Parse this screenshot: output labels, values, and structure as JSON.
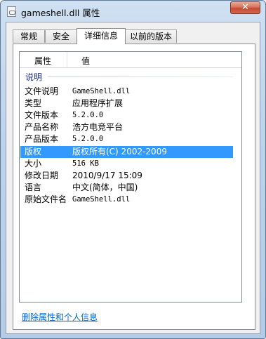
{
  "window": {
    "title": "gameshell.dll 属性",
    "close_label": "✕"
  },
  "tabs": [
    {
      "label": "常规",
      "active": false
    },
    {
      "label": "安全",
      "active": false
    },
    {
      "label": "详细信息",
      "active": true
    },
    {
      "label": "以前的版本",
      "active": false
    }
  ],
  "details": {
    "headers": {
      "property": "属性",
      "value": "值"
    },
    "group_label": "说明",
    "rows": [
      {
        "name": "文件说明",
        "value": "GameShell.dll"
      },
      {
        "name": "类型",
        "value": "应用程序扩展"
      },
      {
        "name": "文件版本",
        "value": "5.2.0.0"
      },
      {
        "name": "产品名称",
        "value": "浩方电竞平台"
      },
      {
        "name": "产品版本",
        "value": "5.2.0.0"
      },
      {
        "name": "版权",
        "value": "版权所有(C) 2002-2009",
        "selected": true
      },
      {
        "name": "大小",
        "value": "516 KB"
      },
      {
        "name": "修改日期",
        "value": "2010/9/17 15:09"
      },
      {
        "name": "语言",
        "value": "中文(简体，中国)"
      },
      {
        "name": "原始文件名",
        "value": "GameShell.dll"
      }
    ]
  },
  "remove_link": "删除属性和个人信息",
  "colors": {
    "selection": "#3399ff",
    "link": "#0066cc",
    "group_label": "#1e3287"
  }
}
